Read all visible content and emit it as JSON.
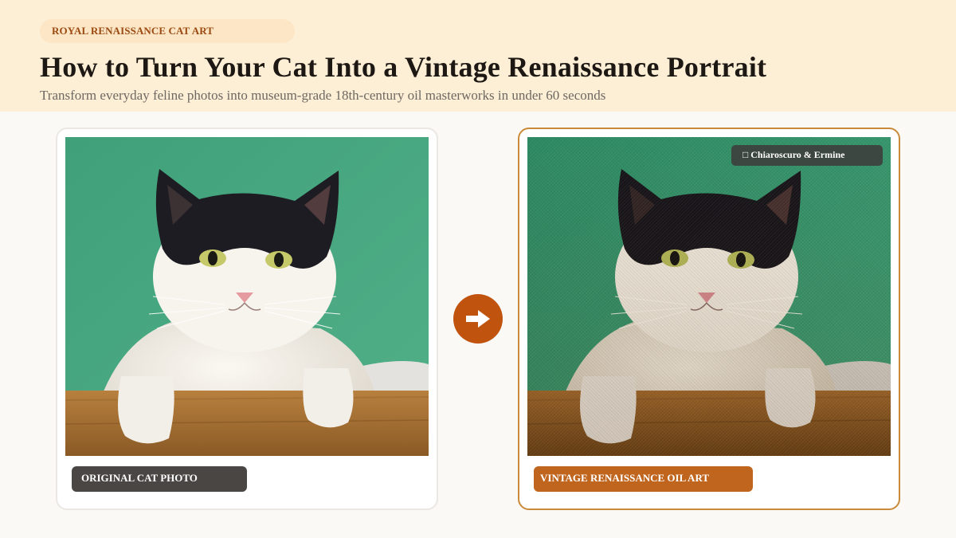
{
  "header": {
    "tag": "ROYAL RENAISSANCE CAT ART",
    "title": "How to Turn Your Cat Into a Vintage Renaissance Portrait",
    "subtitle": "Transform everyday feline photos into museum-grade 18th-century oil masterworks in under 60 seconds"
  },
  "before": {
    "label": "ORIGINAL CAT PHOTO",
    "image_icon": "cat-photo"
  },
  "transform": {
    "icon": "arrow-right-icon",
    "accent": "#c0540f"
  },
  "after": {
    "label": "VINTAGE RENAISSANCE OIL ART",
    "style_chip": "□ Chiaroscuro & Ermine",
    "image_icon": "cat-painting"
  },
  "colors": {
    "header_bg": "#fdefd6",
    "tag_text": "#9a4a12",
    "title": "#1d1813",
    "accent": "#c0651e",
    "dark_label": "#4a4644",
    "card_border_right": "#c98a3a"
  }
}
